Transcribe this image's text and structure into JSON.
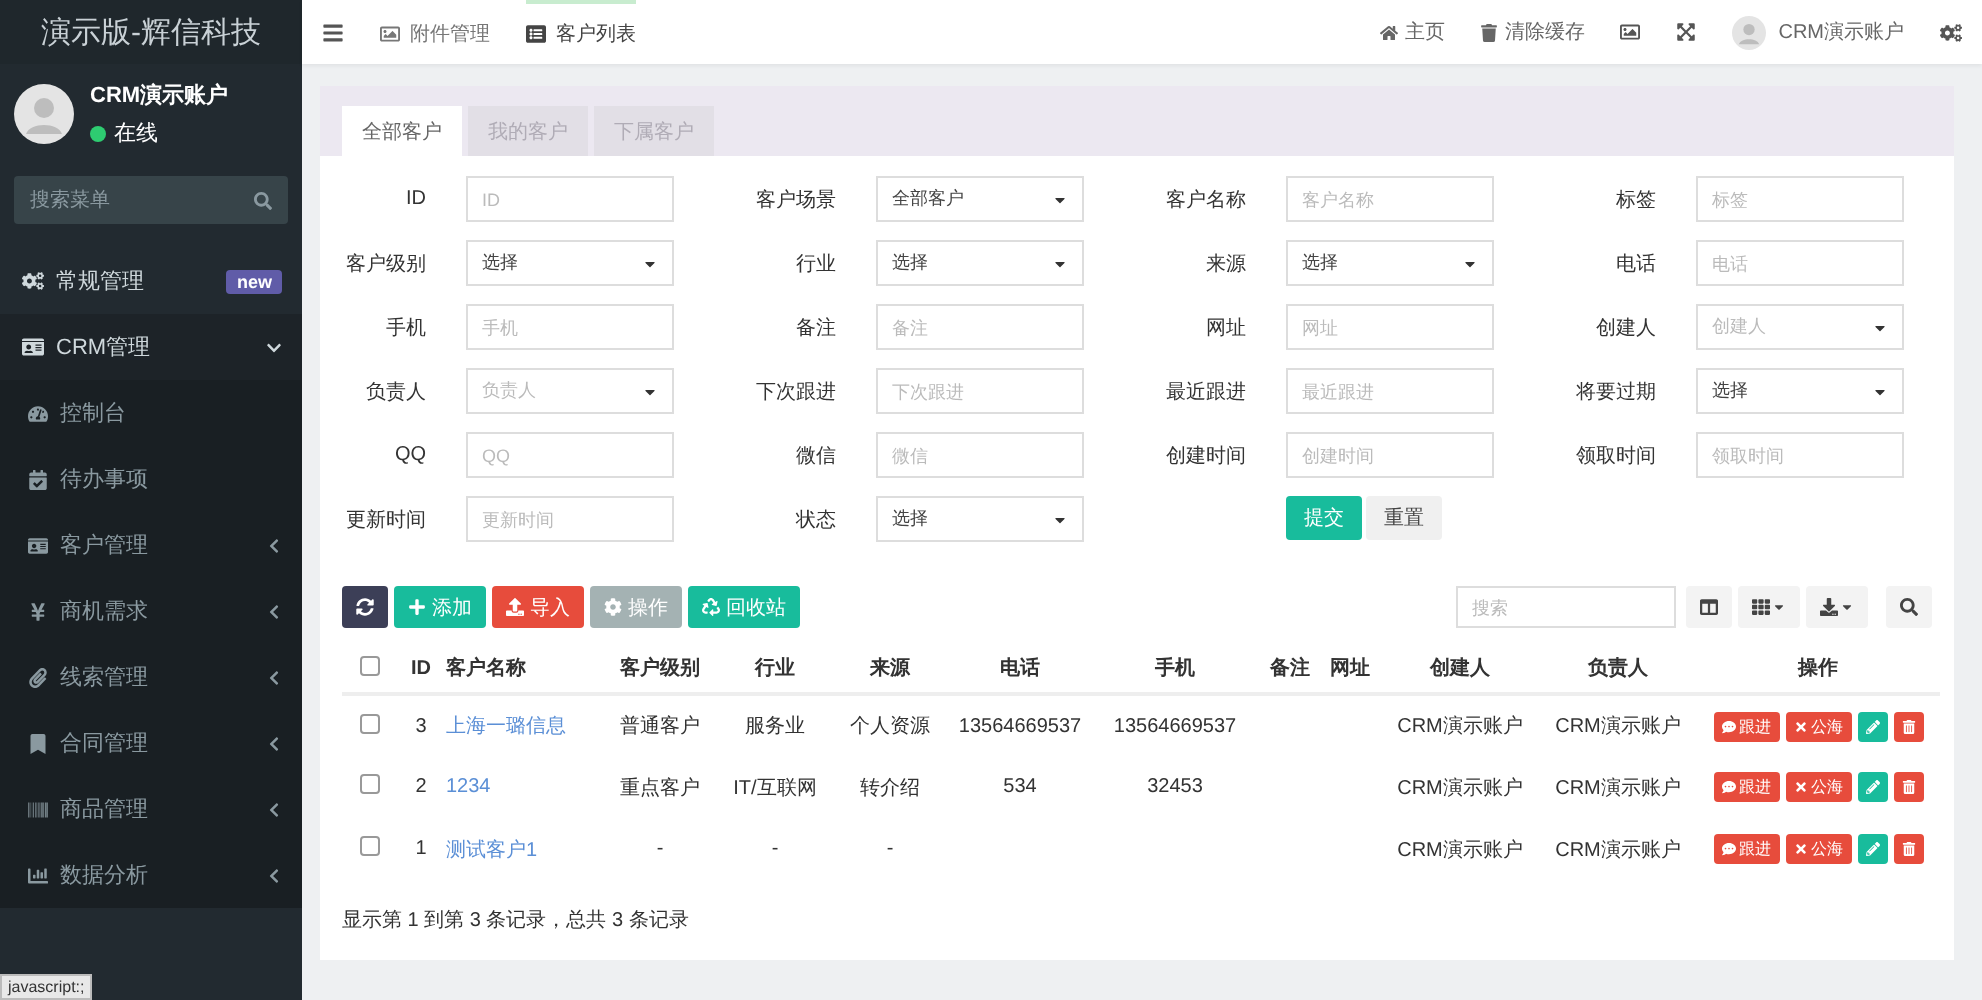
{
  "sidebar": {
    "title": "演示版-辉信科技",
    "user": {
      "name": "CRM演示账户",
      "status": "在线"
    },
    "search": {
      "placeholder": "搜索菜单"
    },
    "items": [
      {
        "label": "常规管理",
        "badge": "new"
      },
      {
        "label": "CRM管理",
        "expanded": true,
        "children": [
          {
            "label": "控制台"
          },
          {
            "label": "待办事项"
          },
          {
            "label": "客户管理",
            "expanded": false
          },
          {
            "label": "商机需求",
            "expanded": false
          },
          {
            "label": "线索管理",
            "expanded": false
          },
          {
            "label": "合同管理",
            "expanded": false
          },
          {
            "label": "商品管理",
            "expanded": false
          },
          {
            "label": "数据分析",
            "expanded": false
          }
        ]
      }
    ]
  },
  "topbar": {
    "tabs": [
      {
        "label": "附件管理",
        "selected": false
      },
      {
        "label": "客户列表",
        "selected": true
      }
    ],
    "links": [
      "主页",
      "清除缓存"
    ],
    "user": "CRM演示账户"
  },
  "tabs": [
    {
      "label": "全部客户",
      "selected": true
    },
    {
      "label": "我的客户",
      "selected": false
    },
    {
      "label": "下属客户",
      "selected": false
    }
  ],
  "form": [
    [
      {
        "label": "ID",
        "kind": "input",
        "placeholder": "ID"
      },
      {
        "label": "客户场景",
        "kind": "select",
        "value": "全部客户"
      },
      {
        "label": "客户名称",
        "kind": "input",
        "placeholder": "客户名称"
      },
      {
        "label": "标签",
        "kind": "input",
        "placeholder": "标签"
      }
    ],
    [
      {
        "label": "客户级别",
        "kind": "select",
        "value": "选择"
      },
      {
        "label": "行业",
        "kind": "select",
        "value": "选择"
      },
      {
        "label": "来源",
        "kind": "select",
        "value": "选择"
      },
      {
        "label": "电话",
        "kind": "input",
        "placeholder": "电话"
      }
    ],
    [
      {
        "label": "手机",
        "kind": "input",
        "placeholder": "手机"
      },
      {
        "label": "备注",
        "kind": "input",
        "placeholder": "备注"
      },
      {
        "label": "网址",
        "kind": "input",
        "placeholder": "网址"
      },
      {
        "label": "创建人",
        "kind": "select",
        "placeholder": "创建人"
      }
    ],
    [
      {
        "label": "负责人",
        "kind": "select",
        "placeholder": "负责人"
      },
      {
        "label": "下次跟进",
        "kind": "input",
        "placeholder": "下次跟进"
      },
      {
        "label": "最近跟进",
        "kind": "input",
        "placeholder": "最近跟进"
      },
      {
        "label": "将要过期",
        "kind": "select",
        "value": "选择"
      }
    ],
    [
      {
        "label": "QQ",
        "kind": "input",
        "placeholder": "QQ"
      },
      {
        "label": "微信",
        "kind": "input",
        "placeholder": "微信"
      },
      {
        "label": "创建时间",
        "kind": "input",
        "placeholder": "创建时间"
      },
      {
        "label": "领取时间",
        "kind": "input",
        "placeholder": "领取时间"
      }
    ],
    [
      {
        "label": "更新时间",
        "kind": "input",
        "placeholder": "更新时间"
      },
      {
        "label": "状态",
        "kind": "select",
        "value": "选择"
      }
    ]
  ],
  "form_buttons": [
    "提交",
    "重置"
  ],
  "toolbar": {
    "buttons": [
      {
        "kind": "refresh"
      },
      {
        "kind": "add",
        "label": "添加"
      },
      {
        "kind": "import",
        "label": "导入"
      },
      {
        "kind": "operate",
        "label": "操作",
        "disabled": true
      },
      {
        "kind": "recycle",
        "label": "回收站"
      }
    ],
    "search": {
      "placeholder": "搜索"
    }
  },
  "table": {
    "header_checked": false,
    "columns": [
      "ID",
      "客户名称",
      "客户级别",
      "行业",
      "来源",
      "电话",
      "手机",
      "备注",
      "网址",
      "创建人",
      "负责人",
      "操作"
    ],
    "rows": [
      {
        "checked": false,
        "cells": [
          "3",
          "上海一璐信息",
          "普通客户",
          "服务业",
          "个人资源",
          "13564669537",
          "13564669537",
          "",
          "",
          "CRM演示账户",
          "CRM演示账户"
        ],
        "actions": [
          "跟进",
          "公海"
        ]
      },
      {
        "checked": false,
        "cells": [
          "2",
          "1234",
          "重点客户",
          "IT/互联网",
          "转介绍",
          "534",
          "32453",
          "",
          "",
          "CRM演示账户",
          "CRM演示账户"
        ],
        "actions": [
          "跟进",
          "公海"
        ]
      },
      {
        "checked": false,
        "cells": [
          "1",
          "测试客户1",
          "-",
          "-",
          "-",
          "",
          "",
          "",
          "",
          "CRM演示账户",
          "CRM演示账户"
        ],
        "actions": [
          "跟进",
          "公海"
        ]
      }
    ]
  },
  "pagination": "显示第 1 到第 3 条记录，总共 3 条记录",
  "status_tooltip": "javascript:;"
}
